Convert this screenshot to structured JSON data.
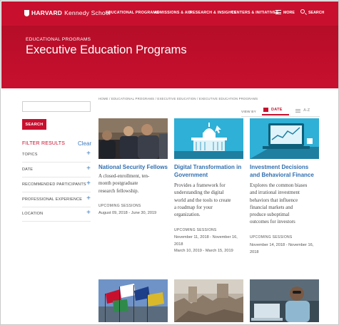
{
  "header": {
    "logo_harvard": "HARVARD",
    "logo_ks": "Kennedy School",
    "nav": [
      "EDUCATIONAL PROGRAMS",
      "ADMISSIONS & AID",
      "RESEARCH & INSIGHTS",
      "CENTERS & INITIATIVES"
    ],
    "more": "MORE",
    "search": "SEARCH"
  },
  "hero": {
    "eyebrow": "EDUCATIONAL PROGRAMS",
    "title": "Executive Education Programs"
  },
  "breadcrumb": "HOME  /  EDUCATIONAL PROGRAMS  /  EXECUTIVE EDUCATION  /  EXECUTIVE EDUCATION PROGRAMS",
  "sidebar": {
    "search_value": "",
    "search_button": "SEARCH",
    "filter_title": "FILTER RESULTS",
    "clear": "Clear",
    "filters": [
      "TOPICS",
      "DATE",
      "RECOMMENDED PARTICIPANTS",
      "PROFESSIONAL EXPERIENCE",
      "LOCATION"
    ]
  },
  "view": {
    "label": "VIEW BY",
    "date": "DATE",
    "az": "A-Z"
  },
  "cards": [
    {
      "title_1": "National Security Fellows",
      "title_2": "",
      "desc": [
        "A closed-enrollment, ten-",
        "month postgraduate",
        "research fellowship."
      ],
      "upcoming": "UPCOMING SESSIONS",
      "dates": [
        "August 09, 2018 - June 30, 2019"
      ]
    },
    {
      "title_1": "Digital Transformation in",
      "title_2": "Government",
      "desc": [
        "Provides a framework for",
        "understanding the digital",
        "world and the tools to create",
        "a roadmap for your",
        "organization."
      ],
      "upcoming": "UPCOMING SESSIONS",
      "dates": [
        "November 11, 2018 - November 16,",
        "2018",
        "March 10, 2019 - March 15, 2019"
      ]
    },
    {
      "title_1": "Investment Decisions",
      "title_2": "and Behavioral Finance",
      "desc": [
        "Explores the common biases",
        "and irrational investment",
        "behaviors that influence",
        "financial markets and",
        "produce suboptimal",
        "outcomes for investors"
      ],
      "upcoming": "UPCOMING SESSIONS",
      "dates": [
        "November 14, 2018 - November 16,",
        "2018"
      ]
    }
  ]
}
